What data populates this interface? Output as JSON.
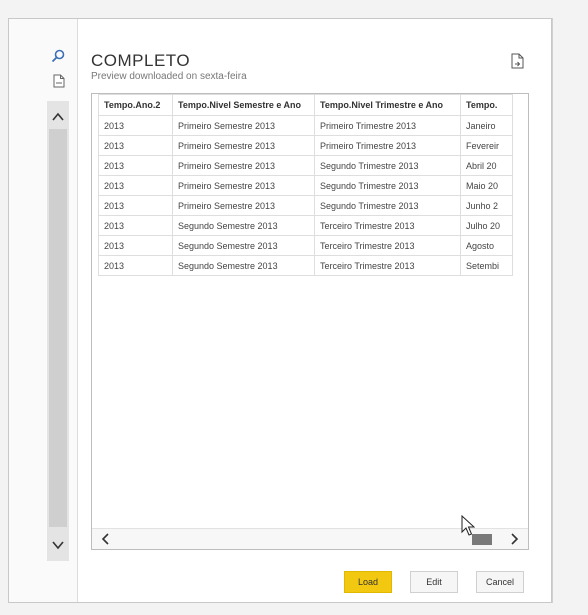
{
  "dialog": {
    "title": "COMPLETO",
    "subtitle": "Preview downloaded on sexta-feira"
  },
  "table": {
    "columns": [
      "Tempo.Ano.2",
      "Tempo.Nivel Semestre e Ano",
      "Tempo.Nivel Trimestre e Ano",
      "Tempo."
    ],
    "rows": [
      [
        "2013",
        "Primeiro Semestre 2013",
        "Primeiro Trimestre 2013",
        "Janeiro"
      ],
      [
        "2013",
        "Primeiro Semestre 2013",
        "Primeiro Trimestre 2013",
        "Fevereir"
      ],
      [
        "2013",
        "Primeiro Semestre 2013",
        "Segundo Trimestre 2013",
        "Abril 20"
      ],
      [
        "2013",
        "Primeiro Semestre 2013",
        "Segundo Trimestre 2013",
        "Maio 20"
      ],
      [
        "2013",
        "Primeiro Semestre 2013",
        "Segundo Trimestre 2013",
        "Junho 2"
      ],
      [
        "2013",
        "Segundo Semestre 2013",
        "Terceiro Trimestre 2013",
        "Julho 20"
      ],
      [
        "2013",
        "Segundo Semestre 2013",
        "Terceiro Trimestre 2013",
        "Agosto"
      ],
      [
        "2013",
        "Segundo Semestre 2013",
        "Terceiro Trimestre 2013",
        "Setembi"
      ]
    ]
  },
  "buttons": {
    "load": "Load",
    "edit": "Edit",
    "cancel": "Cancel"
  },
  "colors": {
    "accent": "#f2c811"
  },
  "icons": [
    "search-icon",
    "file-icon",
    "export-icon",
    "chevron-up-icon",
    "chevron-down-icon",
    "chevron-left-icon",
    "chevron-right-icon",
    "mouse-pointer-icon"
  ]
}
